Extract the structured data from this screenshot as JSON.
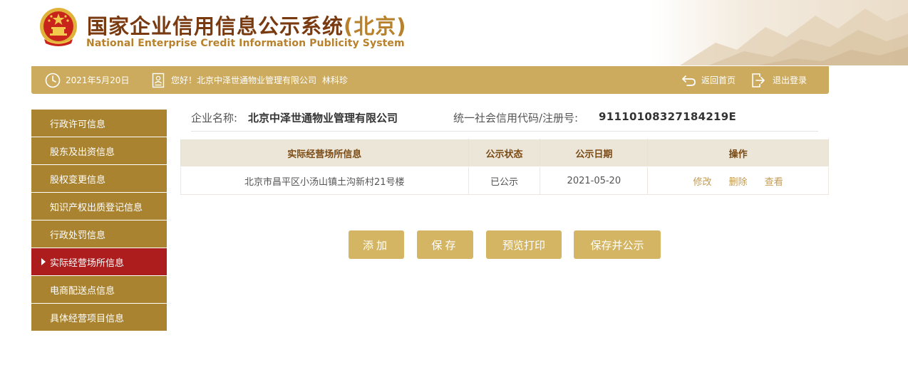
{
  "header": {
    "title_cn_main": "国家企业信用信息公示系统",
    "title_cn_region": "(北京)",
    "title_en": "National Enterprise Credit Information Publicity System",
    "emblem_icon": "national-emblem-icon"
  },
  "infobar": {
    "date": "2021年5月20日",
    "greeting": "您好！北京中泽世通物业管理有限公司",
    "user_name": "林科珍",
    "home_label": "返回首页",
    "logout_label": "退出登录"
  },
  "sidebar": {
    "items": [
      {
        "label": "行政许可信息",
        "active": false
      },
      {
        "label": "股东及出资信息",
        "active": false
      },
      {
        "label": "股权变更信息",
        "active": false
      },
      {
        "label": "知识产权出质登记信息",
        "active": false
      },
      {
        "label": "行政处罚信息",
        "active": false
      },
      {
        "label": "实际经营场所信息",
        "active": true
      },
      {
        "label": "电商配送点信息",
        "active": false
      },
      {
        "label": "具体经营项目信息",
        "active": false
      }
    ]
  },
  "company": {
    "name_label": "企业名称:",
    "name": "北京中泽世通物业管理有限公司",
    "code_label": "统一社会信用代码/注册号:",
    "code": "91110108327184219E"
  },
  "table": {
    "headers": [
      "实际经营场所信息",
      "公示状态",
      "公示日期",
      "操作"
    ],
    "rows": [
      {
        "address": "北京市昌平区小汤山镇土沟新村21号楼",
        "status": "已公示",
        "date": "2021-05-20",
        "actions": [
          "修改",
          "删除",
          "查看"
        ]
      }
    ]
  },
  "buttons": {
    "add": "添加",
    "save": "保存",
    "print": "预览打印",
    "publish": "保存并公示"
  },
  "colors": {
    "gold_bar": "#ccab5e",
    "sidebar_bg": "#a9832f",
    "sidebar_active": "#ad1d1d",
    "button_bg": "#d3b563",
    "title_brown": "#7a3a10",
    "title_gold": "#b8812c",
    "action_link": "#c29a52"
  }
}
